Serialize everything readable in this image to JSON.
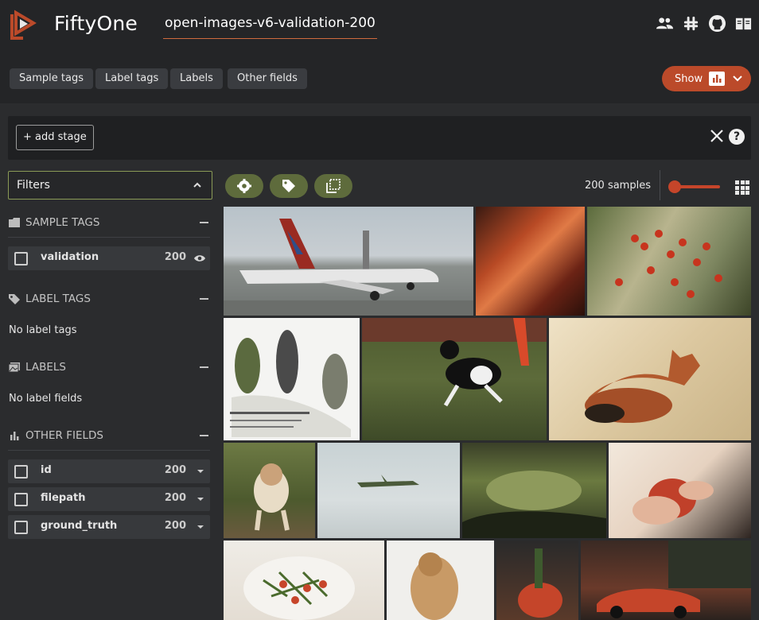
{
  "app": {
    "name": "FiftyOne",
    "dataset": "open-images-v6-validation-200"
  },
  "field_tabs": [
    "Sample tags",
    "Label tags",
    "Labels",
    "Other fields"
  ],
  "show_button": {
    "label": "Show"
  },
  "view_bar": {
    "add_stage": "+ add stage",
    "help": "?"
  },
  "sidebar": {
    "filters_label": "Filters",
    "sample_tags": {
      "title": "SAMPLE TAGS",
      "items": [
        {
          "name": "validation",
          "count": "200"
        }
      ]
    },
    "label_tags": {
      "title": "LABEL TAGS",
      "empty": "No label tags"
    },
    "labels": {
      "title": "LABELS",
      "empty": "No label fields"
    },
    "other_fields": {
      "title": "OTHER FIELDS",
      "items": [
        {
          "name": "id",
          "count": "200"
        },
        {
          "name": "filepath",
          "count": "200"
        },
        {
          "name": "ground_truth",
          "count": "200"
        }
      ]
    }
  },
  "grid": {
    "count_label": "200 samples"
  },
  "icons": {
    "header": [
      "people-icon",
      "slack-icon",
      "github-icon",
      "docs-book-icon"
    ],
    "toolbar": [
      "settings-gear-icon",
      "tag-icon",
      "select-icon"
    ]
  },
  "colors": {
    "accent": "#bb4a2a",
    "olive": "#5e6b3c",
    "background": "#2b2c2e"
  }
}
